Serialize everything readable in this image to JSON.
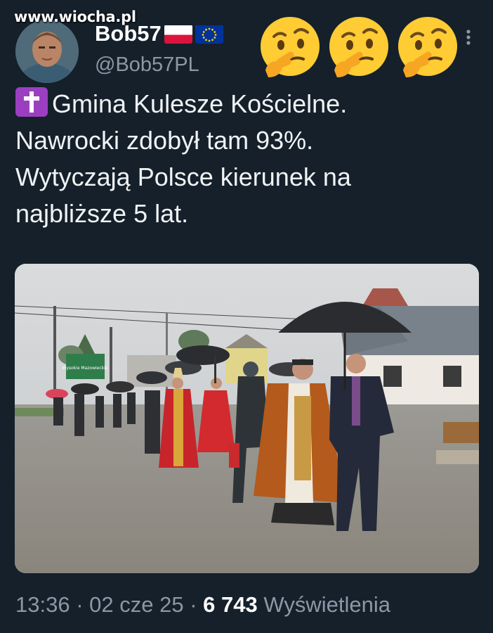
{
  "watermark": "www.wiocha.pl",
  "author": {
    "display_name": "Bob57",
    "handle": "@Bob57PL",
    "name_flags": [
      "poland-flag-icon",
      "eu-flag-icon"
    ],
    "avatar": "user-avatar-photo"
  },
  "header_emojis": [
    "thinking-face-icon",
    "thinking-face-icon",
    "thinking-face-icon"
  ],
  "tweet": {
    "lead_icon": "latin-cross-icon",
    "lines": [
      "Gmina Kulesze Kościelne.",
      "Nawrocki zdobył tam 93%.",
      "Wytyczają Polsce kierunek na",
      "najbliższe 5 lat."
    ]
  },
  "media": {
    "description": "photo-religious-procession-in-rain",
    "sign_text": "Wysokie Mazowieckie"
  },
  "meta": {
    "time": "13:36",
    "separator": "·",
    "date": "02 cze 25",
    "views_count": "6 743",
    "views_label": "Wyświetlenia"
  },
  "colors": {
    "background": "#15202b",
    "text": "#e7e9ea",
    "secondary_text": "#8b98a5",
    "emoji_cross_badge": "#9b3fc0"
  }
}
